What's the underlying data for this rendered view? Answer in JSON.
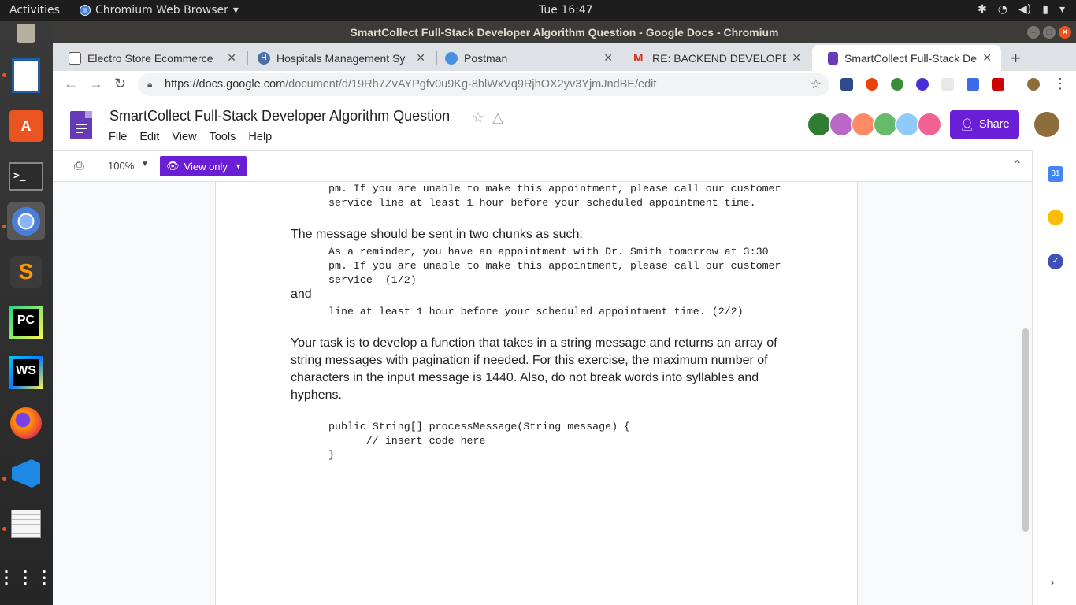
{
  "topbar": {
    "activities": "Activities",
    "app_name": "Chromium Web Browser",
    "clock": "Tue 16:47"
  },
  "window": {
    "title": "SmartCollect Full-Stack Developer Algorithm Question - Google Docs - Chromium"
  },
  "tabs": [
    {
      "label": "Electro Store Ecommerce",
      "icon_color": "#ffffff"
    },
    {
      "label": "Hospitals Management Sy",
      "icon_color": "#4a6fa5"
    },
    {
      "label": "Postman",
      "icon_color": "#4a90e2"
    },
    {
      "label": "RE: BACKEND DEVELOPE",
      "icon_color": "#d93025"
    },
    {
      "label": "SmartCollect Full-Stack De",
      "icon_color": "#673ab7"
    }
  ],
  "omnibox": {
    "host": "https://docs.google.com",
    "path": "/document/d/19Rh7ZvAYPgfv0u9Kg-8blWxVq9RjhOX2yv3YjmJndBE/edit"
  },
  "doc": {
    "title": "SmartCollect Full-Stack Developer Algorithm Question",
    "menu": [
      "File",
      "Edit",
      "View",
      "Tools",
      "Help"
    ],
    "share_label": "Share"
  },
  "docs_toolbar": {
    "zoom": "100%",
    "mode_label": "View only"
  },
  "content": {
    "code1_line1": "pm. If you are unable to make this appointment, please call our customer",
    "code1_line2": "service line at least 1 hour before your scheduled appointment time.",
    "para1": "The message should be sent in two chunks as such:",
    "code2_line1": "As a reminder, you have an appointment with Dr. Smith tomorrow at 3:30",
    "code2_line2": "pm. If you are unable to make this appointment, please call our customer",
    "code2_line3": "service  (1/2)",
    "and": "and",
    "code3_line1": "line at least 1 hour before your scheduled appointment time. (2/2)",
    "para2": "Your task is to develop a function that takes in a string message and returns an array of string messages with pagination if needed. For this exercise, the maximum number of characters in the input message is 1440. Also, do not break words into syllables and hyphens.",
    "code4_line1": "public String[] processMessage(String message) {",
    "code4_line2": "      // insert code here",
    "code4_line3": "}"
  },
  "sidepanel": {
    "calendar_label": "31"
  },
  "colors": {
    "accent": "#6a1fd6",
    "ubuntu_orange": "#e95420"
  }
}
